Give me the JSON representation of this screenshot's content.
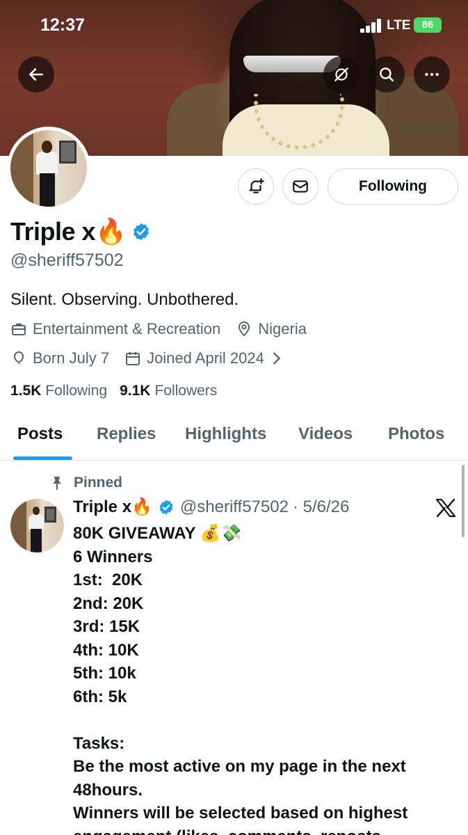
{
  "status_bar": {
    "time": "12:37",
    "network": "LTE",
    "battery": "86"
  },
  "banner": {
    "icons": [
      "back-arrow-icon",
      "grok-icon",
      "search-icon",
      "more-icon"
    ]
  },
  "profile": {
    "name": "Triple x🔥",
    "handle": "@sheriff57502",
    "bio": "Silent. Observing. Unbothered.",
    "category": "Entertainment & Recreation",
    "location": "Nigeria",
    "birthday": "Born July 7",
    "joined": "Joined April 2024",
    "following_count": "1.5K",
    "following_label": "Following",
    "followers_count": "9.1K",
    "followers_label": "Followers",
    "verified_color": "#1d9bf0"
  },
  "actions": {
    "following_label": "Following"
  },
  "tabs": [
    {
      "label": "Posts",
      "active": true
    },
    {
      "label": "Replies",
      "active": false
    },
    {
      "label": "Highlights",
      "active": false
    },
    {
      "label": "Videos",
      "active": false
    },
    {
      "label": "Photos",
      "active": false
    }
  ],
  "post": {
    "pinned_label": "Pinned",
    "author": "Triple x🔥",
    "handle": "@sheriff57502",
    "date": "· 5/6/26",
    "lines": [
      "80K GIVEAWAY 💰💸",
      "6 Winners",
      "1st:  20K",
      "2nd: 20K",
      "3rd: 15K",
      "4th: 10K",
      "5th: 10k",
      "6th: 5k",
      "",
      "Tasks:",
      "Be the most active on my page in the next",
      "48hours.",
      "Winners will be selected based on highest",
      "engagement (likes, comments, reposts"
    ]
  },
  "colors": {
    "accent": "#1d9bf0",
    "text": "#0f1419",
    "secondary": "#536471",
    "border": "#cfd9de"
  }
}
